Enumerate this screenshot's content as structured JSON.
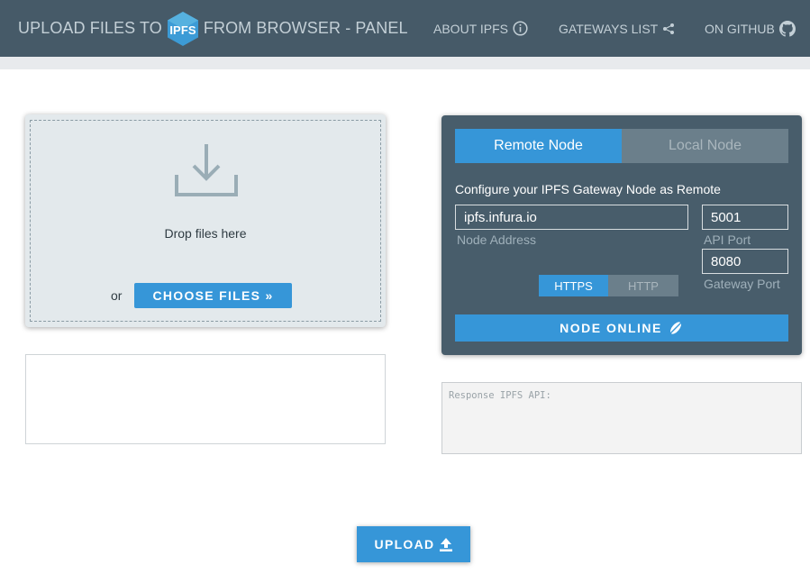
{
  "header": {
    "brand_prefix": "UPLOAD FILES TO",
    "brand_logo_text": "IPFS",
    "brand_suffix": "FROM BROWSER - PANEL",
    "nav": [
      {
        "label": "ABOUT IPFS",
        "icon": "info-circle-icon"
      },
      {
        "label": "GATEWAYS LIST",
        "icon": "share-icon"
      },
      {
        "label": "ON GITHUB",
        "icon": "github-icon"
      }
    ]
  },
  "dropzone": {
    "icon": "download-icon",
    "text": "Drop files here",
    "or_label": "or",
    "choose_button": "CHOOSE FILES »"
  },
  "node_panel": {
    "tabs": [
      {
        "label": "Remote Node",
        "active": true
      },
      {
        "label": "Local Node",
        "active": false
      }
    ],
    "config_title": "Configure your IPFS Gateway Node as Remote",
    "node_address": {
      "value": "ipfs.infura.io",
      "label": "Node Address"
    },
    "api_port": {
      "value": "5001",
      "label": "API Port"
    },
    "gateway_port": {
      "value": "8080",
      "label": "Gateway Port"
    },
    "protocols": [
      {
        "label": "HTTPS",
        "active": true
      },
      {
        "label": "HTTP",
        "active": false
      }
    ],
    "status_button": "NODE ONLINE",
    "status_icon": "satellite-icon"
  },
  "response": {
    "label": "Response IPFS API:"
  },
  "upload_button": {
    "label": "UPLOAD",
    "icon": "upload-icon"
  },
  "colors": {
    "header_bg": "#465a68",
    "panel_bg": "#485d6b",
    "accent": "#3696d8",
    "inactive": "#6b7f8b",
    "dropzone_bg": "#e3e9ec"
  }
}
